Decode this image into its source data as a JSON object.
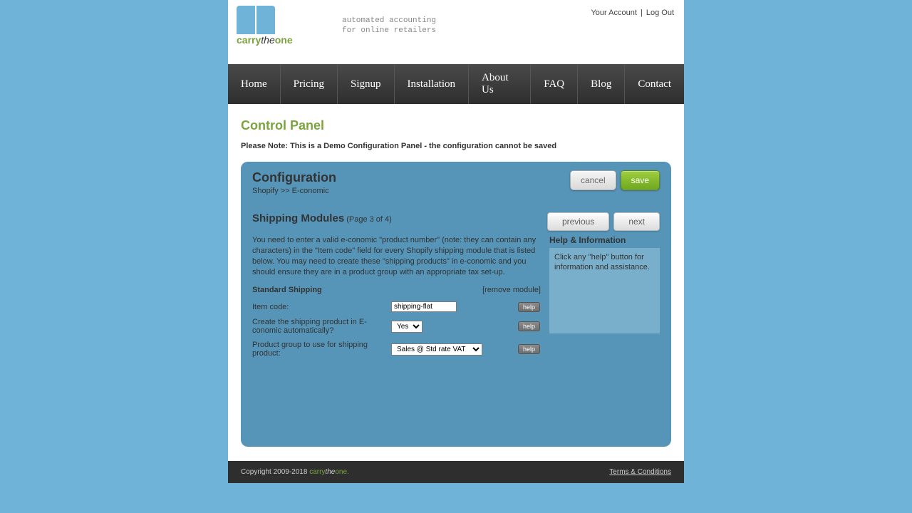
{
  "header": {
    "tagline_line1": "automated accounting",
    "tagline_line2": "for online retailers",
    "logo": {
      "carry": "carry",
      "the": "the",
      "one": "one"
    },
    "account": "Your Account",
    "logout": "Log Out"
  },
  "nav": [
    "Home",
    "Pricing",
    "Signup",
    "Installation",
    "About Us",
    "FAQ",
    "Blog",
    "Contact"
  ],
  "content": {
    "control_panel": "Control Panel",
    "note": "Please Note: This is a Demo Configuration Panel - the configuration cannot be saved"
  },
  "panel": {
    "title": "Configuration",
    "breadcrumb": "Shopify >> E-conomic",
    "cancel": "cancel",
    "save": "save",
    "section_title": "Shipping Modules",
    "page_indicator": "(Page 3 of 4)",
    "previous": "previous",
    "next": "next",
    "intro": "You need to enter a valid e-conomic \"product number\" (note: they can contain any characters) in the \"Item code\" field for every Shopify shipping module that is listed below. You may need to create these \"shipping products\" in e-conomic and you should ensure they are in a product group with an appropriate tax set-up.",
    "module": {
      "name": "Standard Shipping",
      "remove": "[remove module]",
      "item_code_label": "Item code:",
      "item_code_value": "shipping-flat",
      "auto_create_label": "Create the shipping product in E-conomic automatically?",
      "auto_create_value": "Yes",
      "product_group_label": "Product group to use for shipping product:",
      "product_group_value": "Sales @ Std rate VAT",
      "help": "help"
    },
    "help_title": "Help & Information",
    "help_text": "Click any \"help\" button for information and assistance."
  },
  "footer": {
    "copyright": "Copyright 2009-2018 ",
    "brand": {
      "carry": "carry",
      "the": "the",
      "one": "one."
    },
    "terms": "Terms & Conditions"
  }
}
